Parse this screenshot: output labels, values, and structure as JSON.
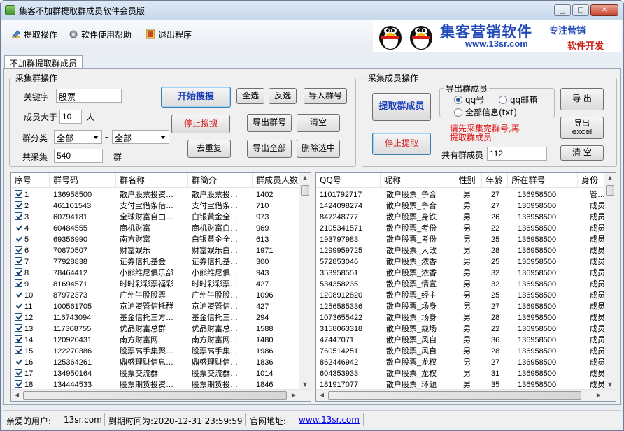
{
  "window": {
    "title": "集客不加群提取群成员软件会员版"
  },
  "toolbar": {
    "extract": "提取操作",
    "help": "软件使用帮助",
    "exit": "退出程序"
  },
  "banner": {
    "brand": "集客营销软件",
    "slogan1": "专注营销",
    "url": "www.13sr.com",
    "slogan2": "软件开发"
  },
  "tab": {
    "label": "不加群提取群成员"
  },
  "collect_group": {
    "title": "采集群操作",
    "keyword_label": "关键字",
    "keyword_value": "股票",
    "members_gt_label": "成员大于",
    "members_gt_value": "10",
    "members_unit": "人",
    "category_label": "群分类",
    "category1": "全部",
    "dash": "-",
    "category2": "全部",
    "total_label": "共采集",
    "total_value": "540",
    "total_unit": "群",
    "start_search": "开始搜搜",
    "stop_search": "停止搜搜",
    "dedupe": "去重复",
    "select_all": "全选",
    "invert": "反选",
    "import_group": "导入群号",
    "export_group": "导出群号",
    "clear": "清空",
    "export_all": "导出全部",
    "delete_selected": "删除选中"
  },
  "collect_member": {
    "title": "采集成员操作",
    "extract_members": "提取群成员",
    "stop_extract": "停止提取",
    "export_group_title": "导出群成员",
    "opt_qq": "qq号",
    "opt_qqmail": "qq邮箱",
    "opt_all": "全部信息(txt)",
    "hint": "请先采集完群号,再提取群成员",
    "total_label": "共有群成员",
    "total_value": "112",
    "export": "导 出",
    "export_excel": "导出\nexcel",
    "clear": "清 空"
  },
  "group_table": {
    "columns": [
      "序号",
      "群号码",
      "群名称",
      "群简介",
      "群成员人数"
    ],
    "rows": [
      [
        "1",
        "136958500",
        "散户股票投资…",
        "散户股票投…",
        "1402"
      ],
      [
        "2",
        "461101543",
        "支付宝借条借…",
        "支付宝借条…",
        "710"
      ],
      [
        "3",
        "60794181",
        "全球财富自由…",
        "白银黄金全…",
        "973"
      ],
      [
        "4",
        "60484555",
        "商机财富",
        "商机财富白…",
        "969"
      ],
      [
        "5",
        "69356990",
        "南方财富",
        "白银黄金全…",
        "613"
      ],
      [
        "6",
        "70870507",
        "财富娱乐",
        "财富娱乐白…",
        "1971"
      ],
      [
        "7",
        "77928838",
        "证券信托基金",
        "证券信托基…",
        "300"
      ],
      [
        "8",
        "78464412",
        "小熊维尼俱乐部",
        "小熊维尼俱…",
        "943"
      ],
      [
        "9",
        "81694571",
        "时时彩彩票福彩",
        "时时彩彩票…",
        "427"
      ],
      [
        "10",
        "87972373",
        "广州牛股股票",
        "广州牛股股…",
        "1096"
      ],
      [
        "11",
        "100561705",
        "京沪资管信托群",
        "京沪资管信…",
        "427"
      ],
      [
        "12",
        "116743094",
        "基金信托三方…",
        "基金信托三…",
        "294"
      ],
      [
        "13",
        "117308755",
        "优品财富总群",
        "优品财富总…",
        "1588"
      ],
      [
        "14",
        "120920431",
        "南方财富网",
        "南方财富网…",
        "1480"
      ],
      [
        "15",
        "122270386",
        "股票高手集聚…",
        "股票高手集…",
        "1986"
      ],
      [
        "16",
        "125364261",
        "鼎盛理财信息…",
        "鼎盛理财信…",
        "1836"
      ],
      [
        "17",
        "134950164",
        "股票交流群",
        "股票交流群…",
        "1014"
      ],
      [
        "18",
        "134444533",
        "股票期货投资…",
        "股票期货投…",
        "1846"
      ]
    ]
  },
  "member_table": {
    "columns": [
      "QQ号",
      "呢称",
      "性别",
      "年龄",
      "所在群号",
      "身份"
    ],
    "rows": [
      [
        "1101792717",
        "散户股票_争合",
        "男",
        "27",
        "136958500",
        "管…"
      ],
      [
        "1424098274",
        "散户股票_争合",
        "男",
        "27",
        "136958500",
        "成员"
      ],
      [
        "847248777",
        "散户股票_身铁",
        "男",
        "26",
        "136958500",
        "成员"
      ],
      [
        "2105341571",
        "散户股票_考份",
        "男",
        "22",
        "136958500",
        "成员"
      ],
      [
        "193797983",
        "散户股票_考份",
        "男",
        "25",
        "136958500",
        "成员"
      ],
      [
        "1299959725",
        "散户股票_大改",
        "男",
        "28",
        "136958500",
        "成员"
      ],
      [
        "572853046",
        "散户股票_浓香",
        "男",
        "25",
        "136958500",
        "成员"
      ],
      [
        "353958551",
        "散户股票_浓香",
        "男",
        "32",
        "136958500",
        "成员"
      ],
      [
        "534358235",
        "散户股票_情宣",
        "男",
        "32",
        "136958500",
        "成员"
      ],
      [
        "1208912820",
        "散户股票_经主",
        "男",
        "25",
        "136958500",
        "成员"
      ],
      [
        "1256585336",
        "散户股票_场身",
        "男",
        "27",
        "136958500",
        "成员"
      ],
      [
        "1073655422",
        "散户股票_场身",
        "男",
        "28",
        "136958500",
        "成员"
      ],
      [
        "3158063318",
        "散户股票_窥场",
        "男",
        "22",
        "136958500",
        "成员"
      ],
      [
        "47447071",
        "散户股票_风自",
        "男",
        "36",
        "136958500",
        "成员"
      ],
      [
        "760514251",
        "散户股票_风自",
        "男",
        "28",
        "136958500",
        "成员"
      ],
      [
        "862446942",
        "散户股票_龙权",
        "男",
        "27",
        "136958500",
        "成员"
      ],
      [
        "604353933",
        "散户股票_龙权",
        "男",
        "31",
        "136958500",
        "成员"
      ],
      [
        "181917077",
        "散户股票_环题",
        "男",
        "35",
        "136958500",
        "成员"
      ]
    ]
  },
  "status": {
    "user_label": "亲爱的用户:",
    "user_value": "13sr.com",
    "expire": "到期时间为:2020-12-31 23:59:59",
    "site_label": "官网地址:",
    "site_url": "www.13sr.com"
  }
}
